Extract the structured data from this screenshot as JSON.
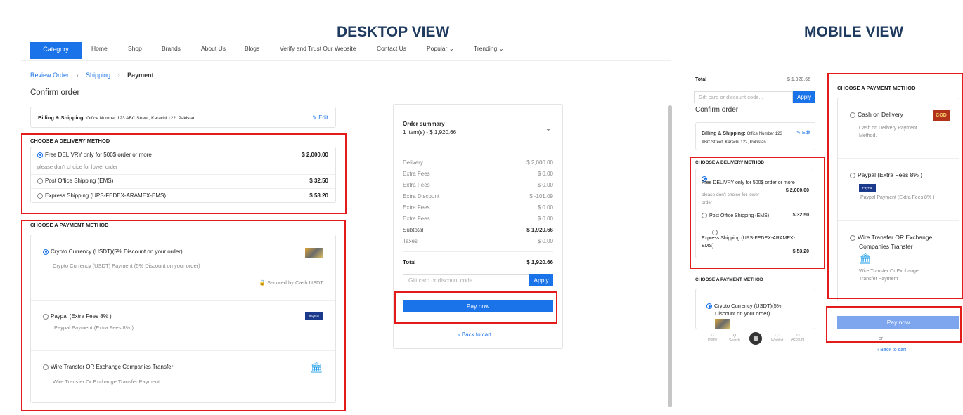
{
  "titles": {
    "desktop": "DESKTOP VIEW",
    "mobile": "MOBILE VIEW"
  },
  "nav": {
    "category": "Category",
    "items": [
      "Home",
      "Shop",
      "Brands",
      "About Us",
      "Blogs",
      "Verify and Trust Our Website",
      "Contact Us",
      "Popular",
      "Trending"
    ]
  },
  "breadcrumb": {
    "review": "Review Order",
    "shipping": "Shipping",
    "payment": "Payment"
  },
  "confirm_order": "Confirm order",
  "billing": {
    "label": "Billing & Shipping:",
    "address": "Office Number 123 ABC Street, Karachi 122, Pakistan",
    "edit": "Edit"
  },
  "delivery": {
    "heading": "CHOOSE A DELIVERY METHOD",
    "options": [
      {
        "label": "Free DELIVRY only for 500$ order or more",
        "price": "$ 2,000.00",
        "note": "please don't choice for lower order"
      },
      {
        "label": "Post Office Shipping (EMS)",
        "price": "$ 32.50"
      },
      {
        "label": "Express Shipping (UPS-FEDEX-ARAMEX-EMS)",
        "price": "$ 53.20"
      }
    ]
  },
  "payment": {
    "heading": "CHOOSE A PAYMENT METHOD",
    "crypto": {
      "label": "Crypto Currency (USDT)(5% Discount on your order)",
      "desc": "Crypto Currency (USDT) Payment (5% Discount on your order)",
      "secured": "Secured by Cash USDT"
    },
    "paypal": {
      "label": "Paypal (Extra Fees 8% )",
      "desc": "Paypal Payment (Extra Fees 8% )",
      "logo": "PayPal"
    },
    "wire": {
      "label": "Wire Transfer OR Exchange Companies Transfer",
      "desc": "Wire Transfer Or Exchange Transfer Payment"
    }
  },
  "summary": {
    "title": "Order summary",
    "items": "1 item(s) -  $ 1,920.66",
    "rows": [
      {
        "label": "Delivery",
        "value": "$ 2,000.00"
      },
      {
        "label": "Extra Fees",
        "value": "$ 0.00"
      },
      {
        "label": "Extra Fees",
        "value": "$ 0.00"
      },
      {
        "label": "Extra Discount",
        "value": "$ -101.09"
      },
      {
        "label": "Extra Fees",
        "value": "$ 0.00"
      },
      {
        "label": "Extra Fees",
        "value": "$ 0.00"
      },
      {
        "label": "Subtotal",
        "value": "$ 1,920.66"
      },
      {
        "label": "Taxes",
        "value": "$ 0.00"
      }
    ],
    "total_label": "Total",
    "total_value": "$ 1,920.66",
    "gift_placeholder": "Gift card or discount code...",
    "apply": "Apply",
    "pay_now": "Pay now",
    "back": "Back to cart"
  },
  "mobile": {
    "total_label": "Total",
    "total_value": "$ 1,920.66",
    "gift_placeholder": "Gift card or discount code...",
    "apply": "Apply",
    "confirm_order": "Confirm order",
    "billing_label": "Billing & Shipping:",
    "billing_address_1": "Office Number 123",
    "billing_address_2": "ABC Street, Karachi 122, Pakistan",
    "edit": "Edit",
    "delivery_heading": "CHOOSE A DELIVERY METHOD",
    "free_label": "Free DELIVRY only for 500$ order or more",
    "free_price": "$ 2,000.00",
    "free_note_1": "please don't choice for lower",
    "free_note_2": "order",
    "post_label": "Post Office Shipping (EMS)",
    "post_price": "$ 32.50",
    "express_label_1": "Express Shipping (UPS-FEDEX-ARAMEX-",
    "express_label_2": "EMS)",
    "express_price": "$ 53.20",
    "payment_heading": "CHOOSE A PAYMENT METHOD",
    "crypto_1": "Crypto Currency (USDT)(5%",
    "crypto_2": "Discount on your order)",
    "tabs": [
      "Home",
      "Search",
      "",
      "Wishlist",
      "Account"
    ],
    "right_heading": "CHOOSE A PAYMENT METHOD",
    "cod_label": "Cash on Delivery",
    "cod_desc_1": "Cash on Delivery Payment",
    "cod_desc_2": "Method.",
    "cod_logo": "COD",
    "paypal_label": "Paypal (Extra Fees 8% )",
    "paypal_desc": "Paypal Payment (Extra Fees 8% )",
    "paypal_logo": "PayPal",
    "wire_label_1": "Wire Transfer OR Exchange",
    "wire_label_2": "Companies Transfer",
    "wire_desc_1": "Wire Transfer Or Exchange",
    "wire_desc_2": "Transfer Payment",
    "pay_now": "Pay now",
    "or": "or",
    "back": "Back to cart"
  },
  "colors": {
    "accent": "#1a73e8",
    "highlight": "#e31b1b"
  }
}
